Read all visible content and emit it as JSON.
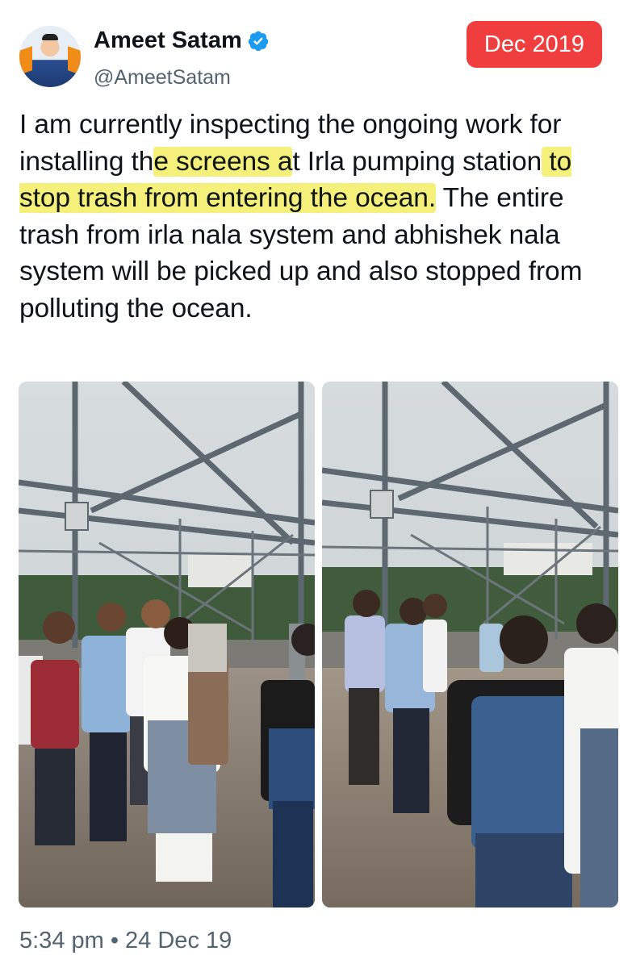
{
  "tweet": {
    "display_name": "Ameet Satam",
    "handle": "@AmeetSatam",
    "verified_icon": "verified-badge-icon",
    "date_badge": "Dec 2019",
    "text_segments": [
      {
        "text": "I am currently inspecting the ongoing work for installing th",
        "highlight": false
      },
      {
        "text": "e screens a",
        "highlight": true
      },
      {
        "text": "t Irla pumping station",
        "highlight": false
      },
      {
        "text": " to stop trash from entering the ocean.",
        "highlight": true
      },
      {
        "text": " The entire trash from irla nala system and abhishek nala system will be picked up and also stopped from polluting the ocean.",
        "highlight": false
      }
    ],
    "timestamp": "5:34 pm • 24 Dec 19"
  },
  "colors": {
    "badge": "#f03e3e",
    "highlight": "#f4f07a",
    "verified": "#1d9bf0",
    "secondary_text": "#536471"
  }
}
